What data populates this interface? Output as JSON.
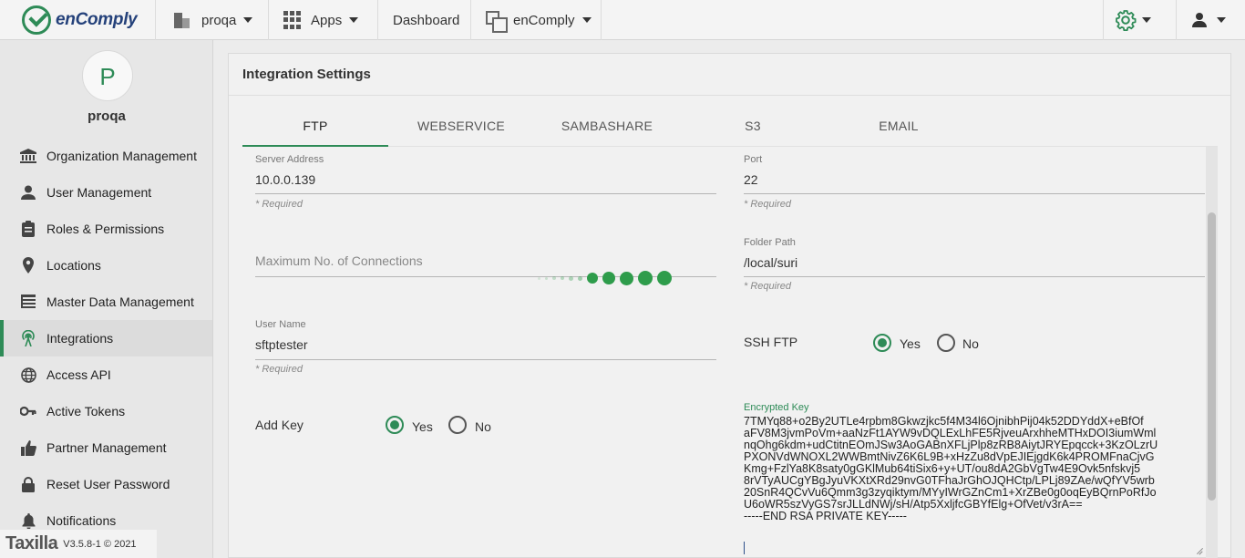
{
  "topbar": {
    "brand": "enComply",
    "org_menu": "proqa",
    "apps_menu": "Apps",
    "dashboard_link": "Dashboard",
    "app_switcher": "enComply"
  },
  "sidebar": {
    "avatar_letter": "P",
    "org_name": "proqa",
    "items": [
      {
        "label": "Organization Management",
        "icon": "bank-icon"
      },
      {
        "label": "User Management",
        "icon": "user-icon"
      },
      {
        "label": "Roles & Permissions",
        "icon": "clipboard-icon"
      },
      {
        "label": "Locations",
        "icon": "pin-icon"
      },
      {
        "label": "Master Data Management",
        "icon": "table-icon"
      },
      {
        "label": "Integrations",
        "icon": "antenna-icon",
        "active": true
      },
      {
        "label": "Access API",
        "icon": "globe-icon"
      },
      {
        "label": "Active Tokens",
        "icon": "key-icon"
      },
      {
        "label": "Partner Management",
        "icon": "thumbs-up-icon"
      },
      {
        "label": "Reset User Password",
        "icon": "lock-icon"
      },
      {
        "label": "Notifications",
        "icon": "bell-icon"
      }
    ],
    "footer_brand": "Taxilla",
    "footer_version": "V3.5.8-1 © 2021"
  },
  "main": {
    "title": "Integration Settings",
    "tabs": [
      "FTP",
      "WEBSERVICE",
      "SAMBASHARE",
      "S3",
      "EMAIL"
    ],
    "active_tab": "FTP",
    "form": {
      "server_address": {
        "label": "Server Address",
        "value": "10.0.0.139",
        "hint": "* Required"
      },
      "port": {
        "label": "Port",
        "value": "22",
        "hint": "* Required"
      },
      "max_connections": {
        "placeholder": "Maximum No. of Connections"
      },
      "folder_path": {
        "label": "Folder Path",
        "value": "/local/suri",
        "hint": "* Required"
      },
      "user_name": {
        "label": "User Name",
        "value": "sftptester",
        "hint": "* Required"
      },
      "ssh_ftp": {
        "label": "SSH FTP",
        "yes": "Yes",
        "no": "No",
        "selected": "Yes"
      },
      "add_key": {
        "label": "Add Key",
        "yes": "Yes",
        "no": "No",
        "selected": "Yes"
      },
      "encrypted_key": {
        "label": "Encrypted Key",
        "value": "7TMYq88+o2By2UTLe4rpbm8Gkwzjkc5f4M34l6OjnibhPij04k52DDYddX+eBfOf\naFV8M3jvmPoVm+aaNzFt1AYW9vDQLExLhFE5RjveuArxhheMTHxDOI3iumWml\nnqOhg6kdm+udCtitnEOmJSw3AoGABnXFLjPlp8zRB8AiytJRYEpqcck+3KzOLzrU\nPXONVdWNOXL2WWBmtNivZ6K6L9B+xHzZu8dVpEJIEjgdK6k4PROMFnaCjvG\nKmg+FzlYa8K8saty0gGKlMub64tiSix6+y+UT/ou8dA2GbVgTw4E9Ovk5nfskvj5\n8rVTyAUCgYBgJyuVKXtXRd29nvG0TFhaJrGhOJQHCtp/LPLj89ZAe/wQfYV5wrb\n20SnR4QCvVu6Qmm3g3zyqiktym/MYyIWrGZnCm1+XrZBe0g0oqEyBQrnPoRfJo\nU6oWR5szVyGS7srJLLdNWj/sH/Atp5XxljfcGBYfElg+OfVet/v3rA==\n-----END RSA PRIVATE KEY-----"
      }
    }
  }
}
